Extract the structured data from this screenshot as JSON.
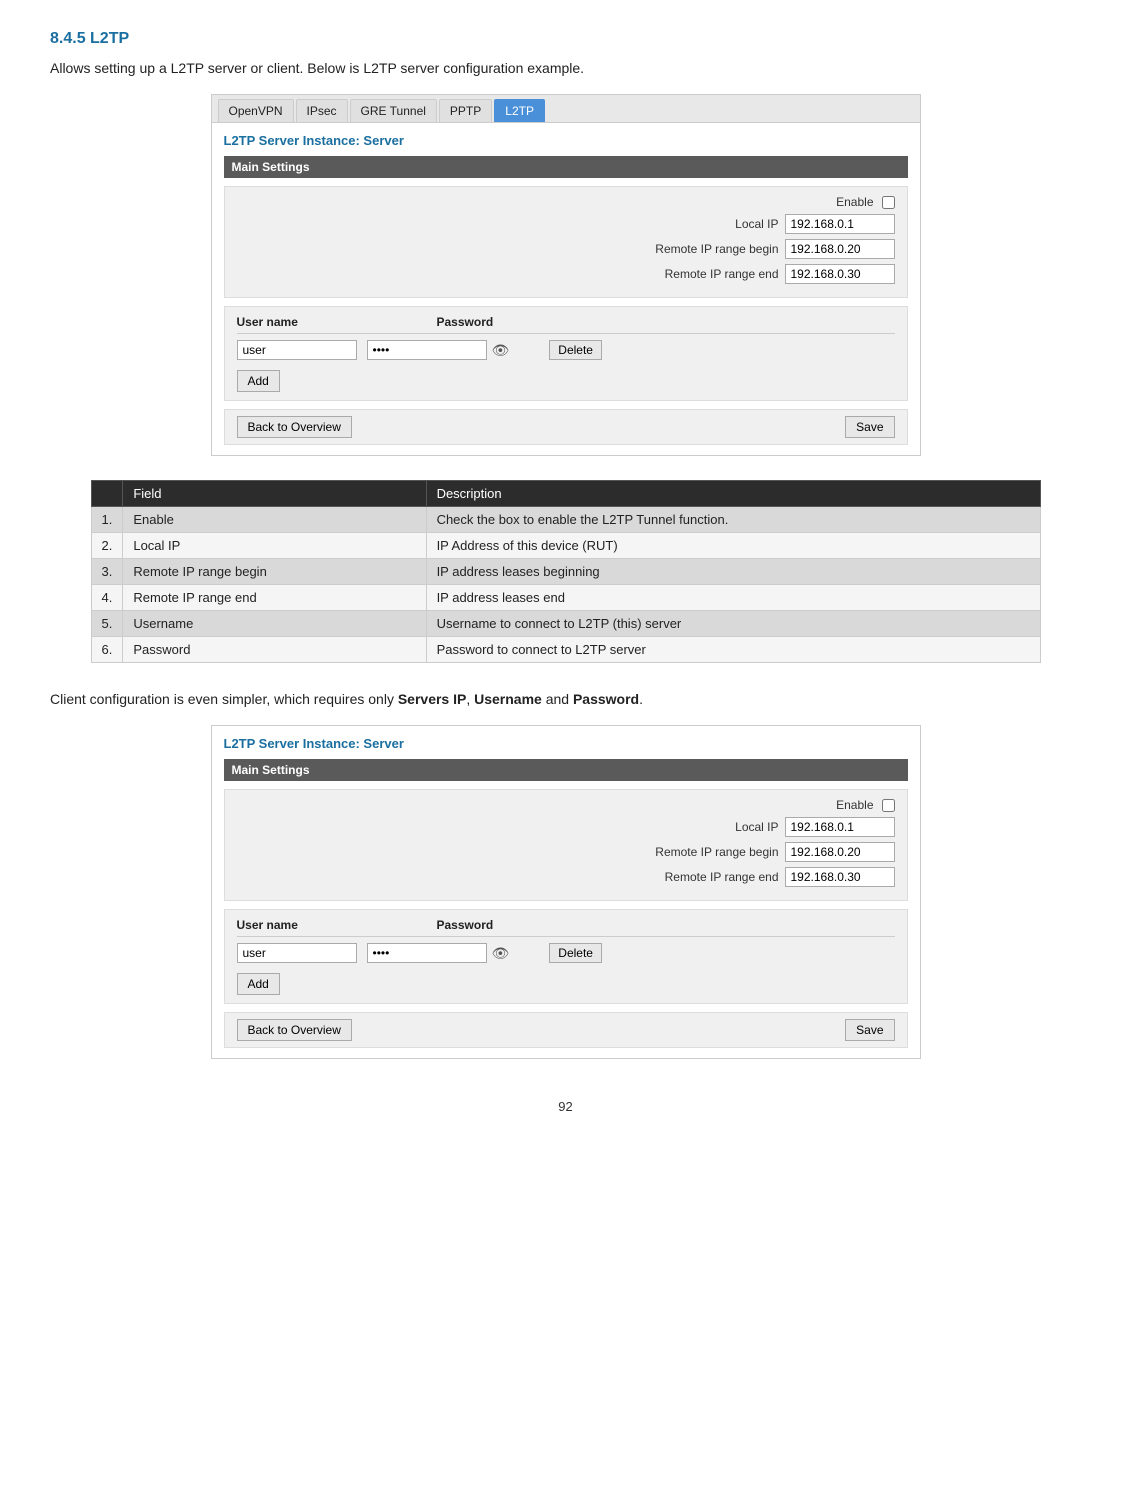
{
  "page": {
    "section": "8.4.5 L2TP",
    "intro": "Allows setting up a L2TP server or client.  Below is L2TP server configuration example.",
    "panel1": {
      "tabs": [
        {
          "label": "OpenVPN",
          "active": false
        },
        {
          "label": "IPsec",
          "active": false
        },
        {
          "label": "GRE Tunnel",
          "active": false
        },
        {
          "label": "PPTP",
          "active": false
        },
        {
          "label": "L2TP",
          "active": true
        }
      ],
      "instance_title": "L2TP Server Instance: Server",
      "main_settings_label": "Main Settings",
      "fields": {
        "enable_label": "Enable",
        "local_ip_label": "Local IP",
        "local_ip_value": "192.168.0.1",
        "remote_begin_label": "Remote IP range begin",
        "remote_begin_value": "192.168.0.20",
        "remote_end_label": "Remote IP range end",
        "remote_end_value": "192.168.0.30"
      },
      "user_table": {
        "col_username": "User name",
        "col_password": "Password",
        "username_value": "user",
        "password_value": "••••",
        "delete_label": "Delete"
      },
      "add_label": "Add",
      "back_label": "Back to Overview",
      "save_label": "Save"
    },
    "table": {
      "headers": [
        "",
        "Field",
        "Description"
      ],
      "rows": [
        {
          "num": "1.",
          "field": "Enable",
          "desc": "Check the box to enable the L2TP Tunnel function."
        },
        {
          "num": "2.",
          "field": "Local IP",
          "desc": "IP Address of this device (RUT)"
        },
        {
          "num": "3.",
          "field": "Remote IP range begin",
          "desc": "IP address leases beginning"
        },
        {
          "num": "4.",
          "field": "Remote IP range end",
          "desc": "IP address leases end"
        },
        {
          "num": "5.",
          "field": "Username",
          "desc": "Username to connect to L2TP (this) server"
        },
        {
          "num": "6.",
          "field": "Password",
          "desc": "Password to connect to L2TP server"
        }
      ]
    },
    "client_text_before": "Client configuration is even simpler, which requires only ",
    "client_bold1": "Servers IP",
    "client_text_mid1": ", ",
    "client_bold2": "Username",
    "client_text_mid2": " and ",
    "client_bold3": "Password",
    "client_text_after": ".",
    "panel2": {
      "instance_title": "L2TP Server Instance: Server",
      "main_settings_label": "Main Settings",
      "fields": {
        "enable_label": "Enable",
        "local_ip_label": "Local IP",
        "local_ip_value": "192.168.0.1",
        "remote_begin_label": "Remote IP range begin",
        "remote_begin_value": "192.168.0.20",
        "remote_end_label": "Remote IP range end",
        "remote_end_value": "192.168.0.30"
      },
      "user_table": {
        "col_username": "User name",
        "col_password": "Password",
        "username_value": "user",
        "password_value": "••••",
        "delete_label": "Delete"
      },
      "add_label": "Add",
      "back_label": "Back to Overview",
      "save_label": "Save"
    },
    "page_number": "92"
  }
}
